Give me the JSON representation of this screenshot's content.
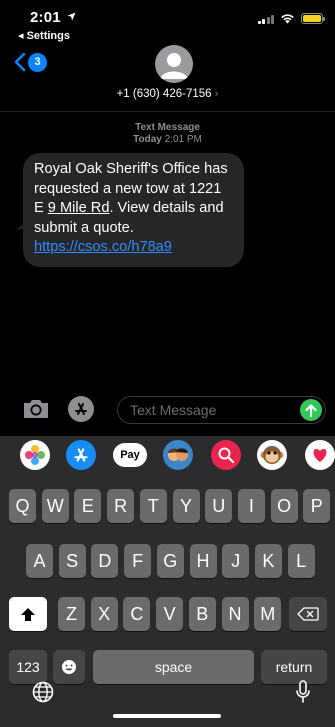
{
  "status_bar": {
    "time": "2:01",
    "back_app": "◂ Settings"
  },
  "header": {
    "unread_count": "3",
    "contact": "+1 (630) 426-7156",
    "chevron": "›"
  },
  "conversation": {
    "message_type": "Text Message",
    "timestamp_day": "Today",
    "timestamp_time": "2:01 PM",
    "message": {
      "part1": "Royal Oak Sheriff's Office has requested a new tow at 1221 E ",
      "address_underlined": "9 Mile Rd",
      "part2": ". View details and submit a quote. ",
      "link": "https://csos.co/h78a9"
    }
  },
  "input": {
    "placeholder": "Text Message"
  },
  "app_drawer": {
    "items": [
      {
        "name": "photos-app-icon"
      },
      {
        "name": "app-store-app-icon"
      },
      {
        "name": "apple-pay-app-icon",
        "label": "Pay"
      },
      {
        "name": "memoji-app-icon"
      },
      {
        "name": "image-search-app-icon"
      },
      {
        "name": "animoji-app-icon"
      },
      {
        "name": "digital-touch-app-icon"
      }
    ]
  },
  "keyboard": {
    "row1": [
      "Q",
      "W",
      "E",
      "R",
      "T",
      "Y",
      "U",
      "I",
      "O",
      "P"
    ],
    "row2": [
      "A",
      "S",
      "D",
      "F",
      "G",
      "H",
      "J",
      "K",
      "L"
    ],
    "row3": [
      "Z",
      "X",
      "C",
      "V",
      "B",
      "N",
      "M"
    ],
    "numbers_key": "123",
    "space_key": "space",
    "return_key": "return"
  },
  "colors": {
    "accent": "#0a84ff",
    "send": "#32c759",
    "bubble": "#262629",
    "link": "#2f8cff",
    "keyboard_bg": "#2c2c2e"
  },
  "icons": [
    "location-arrow-icon",
    "signal-icon",
    "wifi-icon",
    "battery-icon",
    "back-chevron-icon",
    "person-icon",
    "camera-icon",
    "app-store-icon",
    "send-arrow-icon",
    "shift-icon",
    "delete-icon",
    "emoji-icon",
    "globe-icon",
    "microphone-icon"
  ]
}
